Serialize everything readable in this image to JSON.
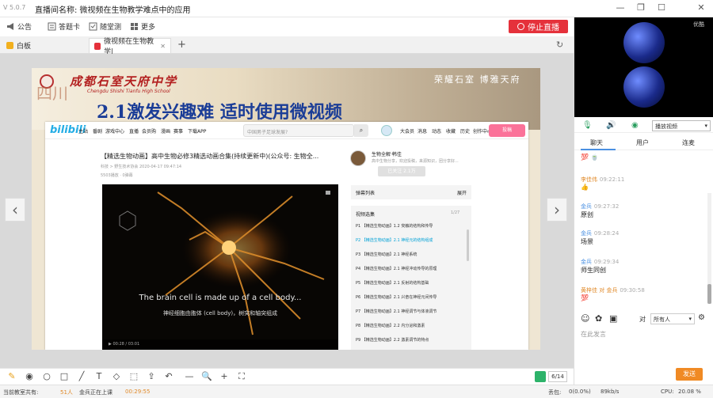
{
  "window": {
    "version": "V 5.0.7",
    "title": "直播间名称: 微视频在生物教学难点中的应用",
    "min": "—",
    "restore": "❐",
    "max": "☐",
    "close": "✕"
  },
  "toolbar": {
    "items": [
      {
        "label": "公告",
        "icon": "megaphone-icon"
      },
      {
        "label": "答题卡",
        "icon": "answer-card-icon"
      },
      {
        "label": "随堂测",
        "icon": "quiz-icon"
      },
      {
        "label": "更多",
        "icon": "more-grid-icon"
      }
    ],
    "stop_live": "停止直播"
  },
  "tabs": {
    "tab1": "白板",
    "tab2": "微视频在生物教学|",
    "close": "✕",
    "add": "+",
    "refresh": "↻"
  },
  "slide": {
    "school_cn": "成都石室天府中学",
    "school_en": "Chengdu Shishi Tianfu High School",
    "motto": "荣耀石室 博雅天府",
    "title": "2.1激发兴趣难 适时使用微视频",
    "calligraphy": "四川",
    "browser": {
      "logo": "bilibili",
      "nav": [
        "主站",
        "番剧",
        "游戏中心",
        "直播",
        "会员购",
        "漫画",
        "赛事",
        "下载APP"
      ],
      "search_placeholder": "中国男子足球发展?",
      "right_nav": [
        "大会员",
        "消息",
        "动态",
        "收藏",
        "历史",
        "创作中心"
      ],
      "upload": "投稿",
      "video_title": "【精选生物动画】高中生物必修3精选动画合集(持续更新中)(公众号: 生物全...",
      "video_meta": "科技 > 野生技术协会    2020-04-17 09:47:14",
      "video_meta2": "5503播放 · 0弹幕",
      "up_name": "生物全解·韩佳",
      "up_desc": "高中生物分享，欢迎投稿，来源知识，团分享好...",
      "follow": "已关注 2.1万",
      "caption_en": "The brain cell is made up of a cell body...",
      "caption_cn": "神经细胞由胞体 (cell body)，树突和轴突组成",
      "controls": "00:28 / 03:01",
      "danmu_label": "弹幕列表",
      "danmu_expand": "展开",
      "playlist_title": "视频选集",
      "playlist_count": "1/27",
      "playlist": [
        "P1 【精选生物动画】1.2 突触的结构和传导",
        "P2 【精选生物动画】2.1 神经元的结构组成",
        "P3 【精选生物动画】2.1 神经系统",
        "P4 【精选生物动画】2.1 神经冲动传导的原理",
        "P5 【精选生物动画】2.1 反射的结构基础",
        "P6 【精选生物动画】2.1 兴奋在神经元间传导",
        "P7 【精选生物动画】2.1 神经调节与体液调节",
        "P8 【精选生物动画】2.2 内分泌和激素",
        "P9 【精选生物动画】2.2 激素调节的特点"
      ]
    }
  },
  "nav": {
    "prev": "‹",
    "next": "›"
  },
  "tools": [
    "✎",
    "◉",
    "○",
    "□",
    "╱",
    "T",
    "◇",
    "⬚",
    "⇪",
    "↶",
    "—",
    "🔍",
    "+",
    "⛶"
  ],
  "page_indicator": "6/14",
  "status": {
    "count_label": "当前教室共有:",
    "count": "51人",
    "teaching": "金兵正在上课",
    "timer": "00:29:55",
    "packet_label": "丢包:",
    "packet": "0(0.0%)",
    "rate": "89kb/s",
    "cpu_label": "CPU:",
    "cpu": "20.08 %"
  },
  "right": {
    "cam_label": "优酷",
    "play_video": "播放视频",
    "chat_tabs": [
      "聊天",
      "用户",
      "连麦"
    ],
    "messages": [
      {
        "name": "",
        "time": "",
        "text": "💯 🍵",
        "teacher": false
      },
      {
        "name": "李佳伟",
        "time": "09:22:11",
        "text": "👍",
        "teacher": true
      },
      {
        "name": "金兵",
        "time": "09:27:32",
        "text": "原创",
        "teacher": false
      },
      {
        "name": "金兵",
        "time": "09:28:24",
        "text": "场景",
        "teacher": false
      },
      {
        "name": "金兵",
        "time": "09:29:34",
        "text": "师生同创",
        "teacher": false
      },
      {
        "name": "黄梓佳 对 金兵",
        "time": "09:30:58",
        "text": "💯",
        "teacher": true
      }
    ],
    "to_label": "对",
    "to_select": "所有人",
    "input_placeholder": "在此发言",
    "send": "发送"
  },
  "colors": {
    "accent": "#e5313b",
    "bili": "#23ade5",
    "send": "#f08a24",
    "title_blue": "#1b3d97"
  }
}
